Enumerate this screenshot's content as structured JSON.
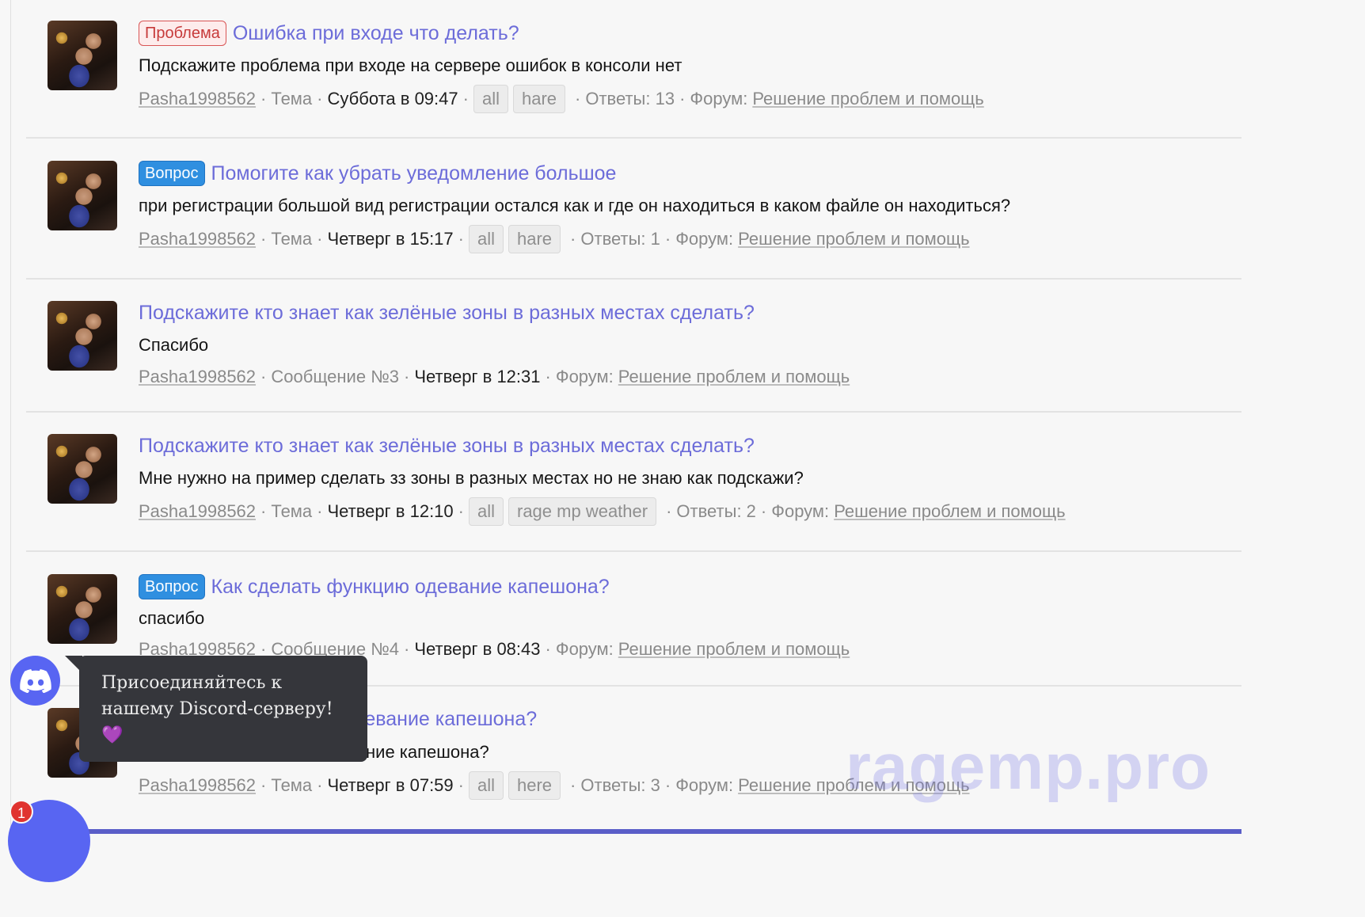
{
  "results": [
    {
      "prefix": "Проблема",
      "prefix_type": "problem",
      "title": "Ошибка при входе что делать?",
      "snippet": "Подскажите проблема при входе на сервере ошибок в консоли нет",
      "author": "Pasha1998562",
      "content_type": "Тема",
      "date": "Суббота в 09:47",
      "tags": [
        "all",
        "hare"
      ],
      "replies": "Ответы: 13",
      "forum_label": "Форум:",
      "forum": "Решение проблем и помощь"
    },
    {
      "prefix": "Вопрос",
      "prefix_type": "question",
      "title": "Помогите как убрать уведомление большое",
      "snippet": "при регистрации большой вид регистрации остался как и где он находиться в каком файле он находиться?",
      "author": "Pasha1998562",
      "content_type": "Тема",
      "date": "Четверг в 15:17",
      "tags": [
        "all",
        "hare"
      ],
      "replies": "Ответы: 1",
      "forum_label": "Форум:",
      "forum": "Решение проблем и помощь"
    },
    {
      "prefix": "",
      "prefix_type": "",
      "title": "Подскажите кто знает как зелёные зоны в разных местах сделать?",
      "snippet": "Спасибо",
      "author": "Pasha1998562",
      "content_type": "Сообщение №3",
      "date": "Четверг в 12:31",
      "tags": [],
      "replies": "",
      "forum_label": "Форум:",
      "forum": "Решение проблем и помощь"
    },
    {
      "prefix": "",
      "prefix_type": "",
      "title": "Подскажите кто знает как зелёные зоны в разных местах сделать?",
      "snippet": "Мне нужно на пример сделать зз зоны в разных местах но не знаю как подскажи?",
      "author": "Pasha1998562",
      "content_type": "Тема",
      "date": "Четверг в 12:10",
      "tags": [
        "all",
        "rage mp weather"
      ],
      "replies": "Ответы: 2",
      "forum_label": "Форум:",
      "forum": "Решение проблем и помощь"
    },
    {
      "prefix": "Вопрос",
      "prefix_type": "question",
      "title": "Как сделать функцию одевание капешона?",
      "snippet": "спасибо",
      "author": "Pasha1998562",
      "content_type": "Сообщение №4",
      "date": "Четверг в 08:43",
      "tags": [],
      "replies": "",
      "forum_label": "Форум:",
      "forum": "Решение проблем и помощь"
    },
    {
      "prefix": "",
      "prefix_type": "",
      "title": "Как сделать функцию одевание капешона?",
      "snippet": "Как сделать функцию одевание капешона?",
      "author": "Pasha1998562",
      "content_type": "Тема",
      "date": "Четверг в 07:59",
      "tags": [
        "all",
        "here"
      ],
      "replies": "Ответы: 3",
      "forum_label": "Форум:",
      "forum": "Решение проблем и помощь"
    }
  ],
  "tooltip": {
    "text": "Присоединяйтесь к нашему Discord-серверу! 💜"
  },
  "notification_count": "1",
  "watermark": "ragemp.pro",
  "colors": {
    "link": "#6c6cd9",
    "problem_label": "#c73b3b",
    "question_label": "#2f8fe0",
    "discord": "#5865f2"
  },
  "icons": {
    "discord_button": "discord-icon"
  }
}
